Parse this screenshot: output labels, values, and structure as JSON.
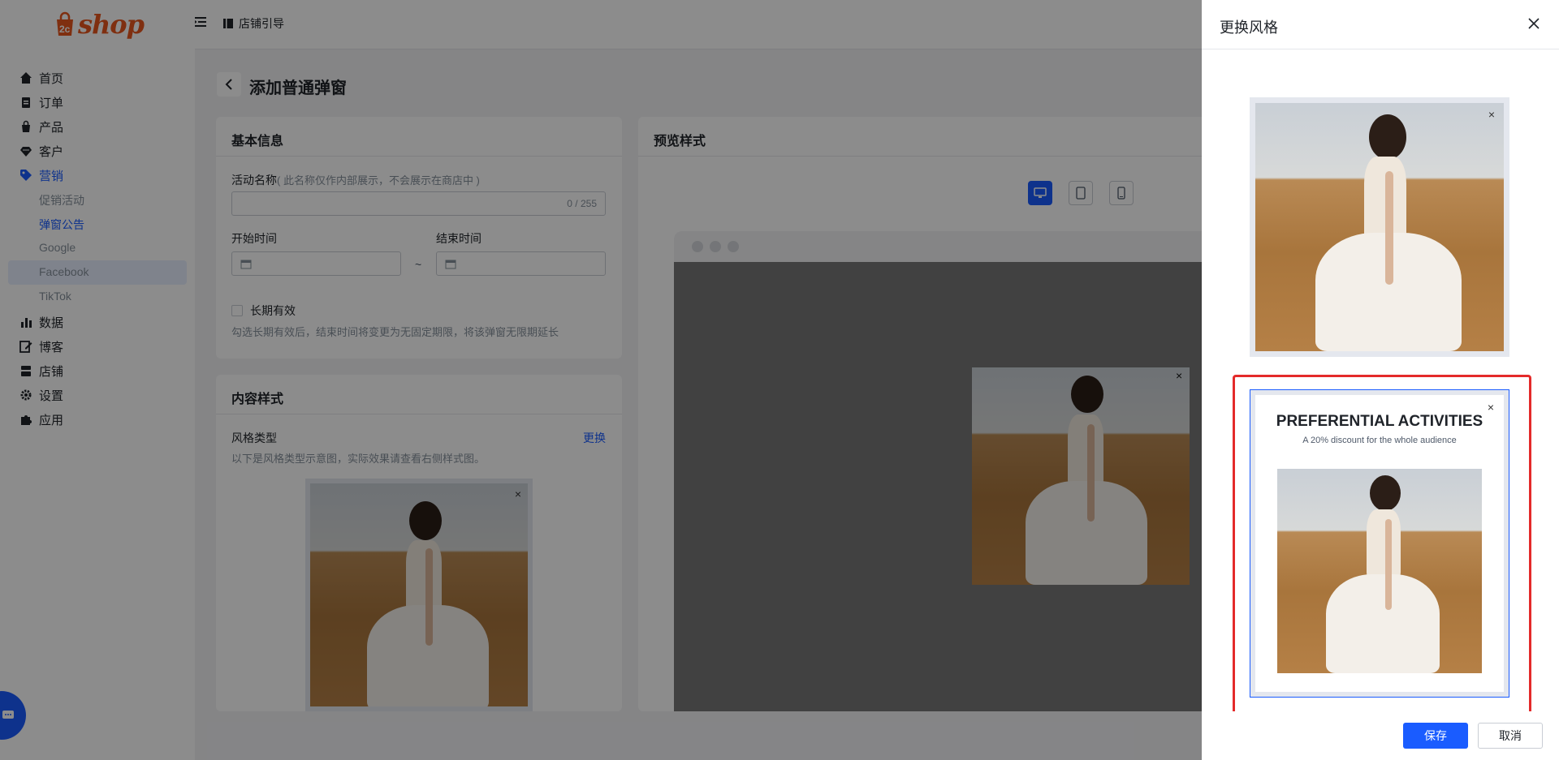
{
  "header": {
    "logo_text": "shop",
    "logo_mark": "2c",
    "guide_label": "店铺引导"
  },
  "sidebar": {
    "items": [
      {
        "label": "首页",
        "icon": "home-icon"
      },
      {
        "label": "订单",
        "icon": "clipboard-icon"
      },
      {
        "label": "产品",
        "icon": "bag-icon"
      },
      {
        "label": "客户",
        "icon": "diamond-icon"
      },
      {
        "label": "营销",
        "icon": "tag-icon"
      },
      {
        "label": "数据",
        "icon": "bar-chart-icon"
      },
      {
        "label": "博客",
        "icon": "edit-icon"
      },
      {
        "label": "店铺",
        "icon": "store-icon"
      },
      {
        "label": "设置",
        "icon": "gear-icon"
      },
      {
        "label": "应用",
        "icon": "puzzle-icon"
      }
    ],
    "sub_items": [
      "促销活动",
      "弹窗公告",
      "Google",
      "Facebook",
      "TikTok"
    ],
    "active_sub": "弹窗公告"
  },
  "page": {
    "title": "添加普通弹窗"
  },
  "basic_info": {
    "title": "基本信息",
    "name_label": "活动名称",
    "name_hint": "( 此名称仅作内部展示，不会展示在商店中 )",
    "name_counter": "0 / 255",
    "start_label": "开始时间",
    "end_label": "结束时间",
    "range_sep": "~",
    "long_term_label": "长期有效",
    "long_term_hint": "勾选长期有效后，结束时间将变更为无固定期限，将该弹窗无限期延长"
  },
  "content_style": {
    "title": "内容样式",
    "style_type_label": "风格类型",
    "change_link": "更换",
    "style_hint": "以下是风格类型示意图，实际效果请查看右侧样式图。",
    "close_glyph": "×"
  },
  "preview": {
    "title": "预览样式",
    "close_glyph": "×"
  },
  "drawer": {
    "title": "更换风格",
    "close_glyph": "×",
    "promo_heading": "PREFERENTIAL ACTIVITIES",
    "promo_sub": "A 20% discount for the whole audience",
    "save_label": "保存",
    "cancel_label": "取消"
  },
  "colors": {
    "accent": "#1a5cff",
    "brand": "#e8571e",
    "selection": "#e42a2a"
  }
}
